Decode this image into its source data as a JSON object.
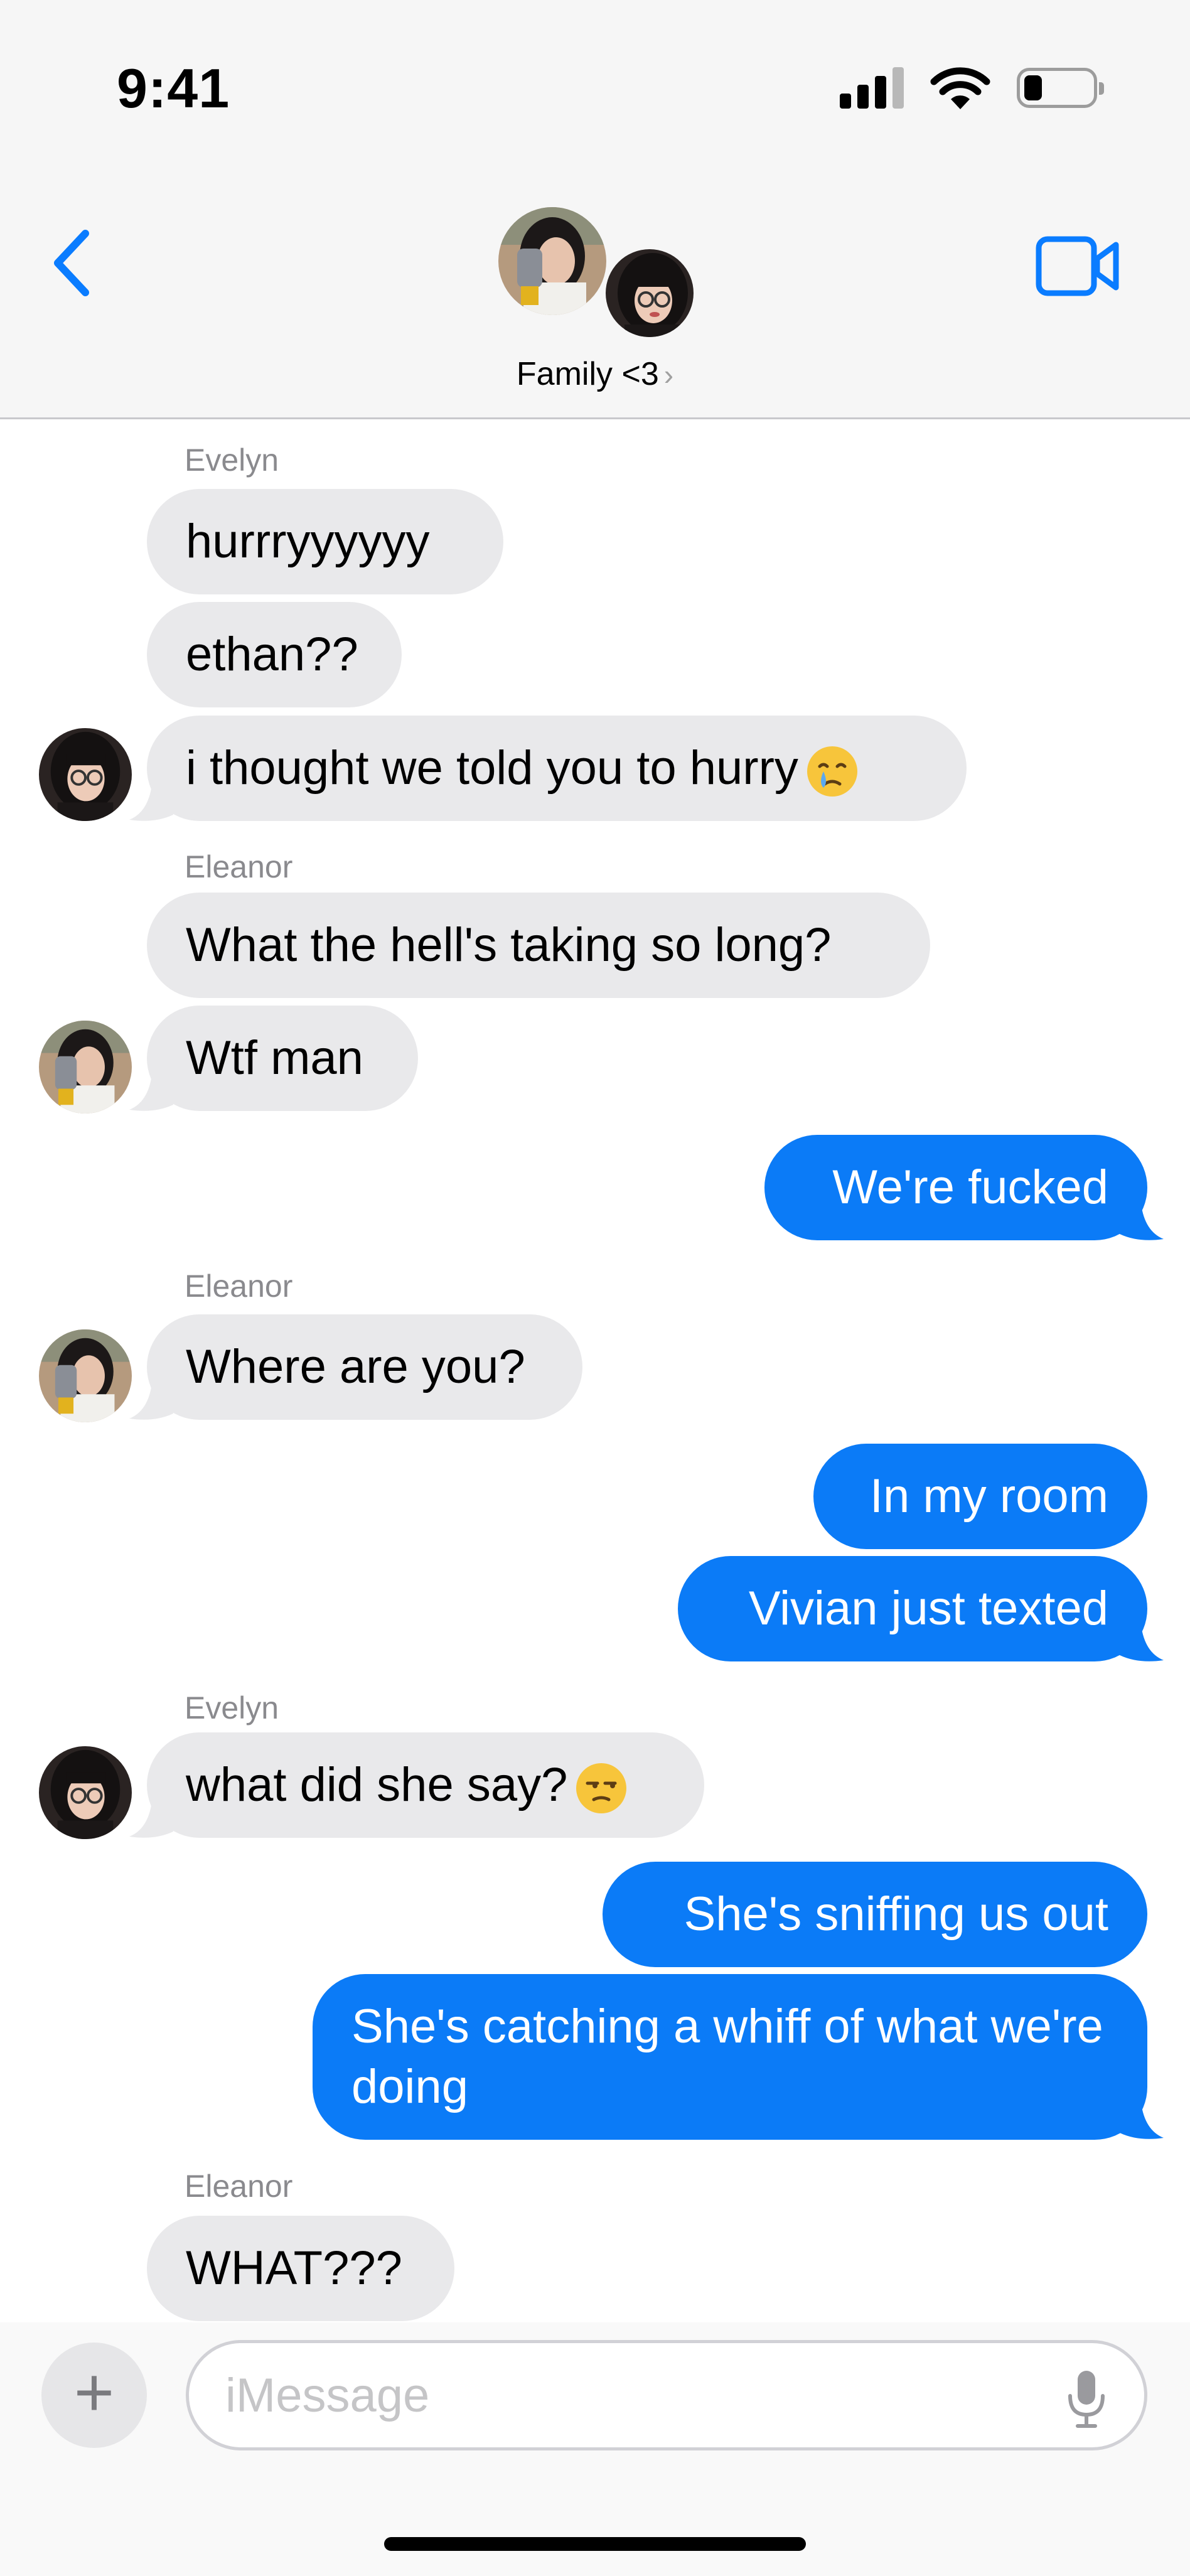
{
  "status_bar": {
    "time": "9:41"
  },
  "header": {
    "title": "Family <3",
    "chevron": "›",
    "back_icon": "chevron-left-icon",
    "video_icon": "video-camera-icon"
  },
  "messages": [
    {
      "sender": "Evelyn",
      "text": "hurrryyyyyy",
      "direction": "in"
    },
    {
      "text": "ethan??",
      "direction": "in"
    },
    {
      "text": "i thought we told you to hurry",
      "emoji": "crying-face",
      "direction": "in"
    },
    {
      "sender": "Eleanor",
      "text": "What the hell's taking so long?",
      "direction": "in"
    },
    {
      "text": "Wtf man",
      "direction": "in"
    },
    {
      "text": "We're fucked",
      "direction": "out"
    },
    {
      "sender": "Eleanor",
      "text": "Where are you?",
      "direction": "in"
    },
    {
      "text": "In my room",
      "direction": "out"
    },
    {
      "text": "Vivian just texted",
      "direction": "out"
    },
    {
      "sender": "Evelyn",
      "text": "what did she say?",
      "emoji": "unamused-face",
      "direction": "in"
    },
    {
      "text": "She's sniffing us out",
      "direction": "out"
    },
    {
      "text": "She's catching a whiff of what we're doing",
      "direction": "out"
    },
    {
      "sender": "Eleanor",
      "text": "WHAT???",
      "direction": "in"
    }
  ],
  "compose": {
    "plus": "+",
    "placeholder": "iMessage",
    "mic_icon": "microphone-icon"
  },
  "colors": {
    "outgoing": "#0b7bf7",
    "incoming": "#e9e9eb",
    "accent": "#0a7cff"
  }
}
